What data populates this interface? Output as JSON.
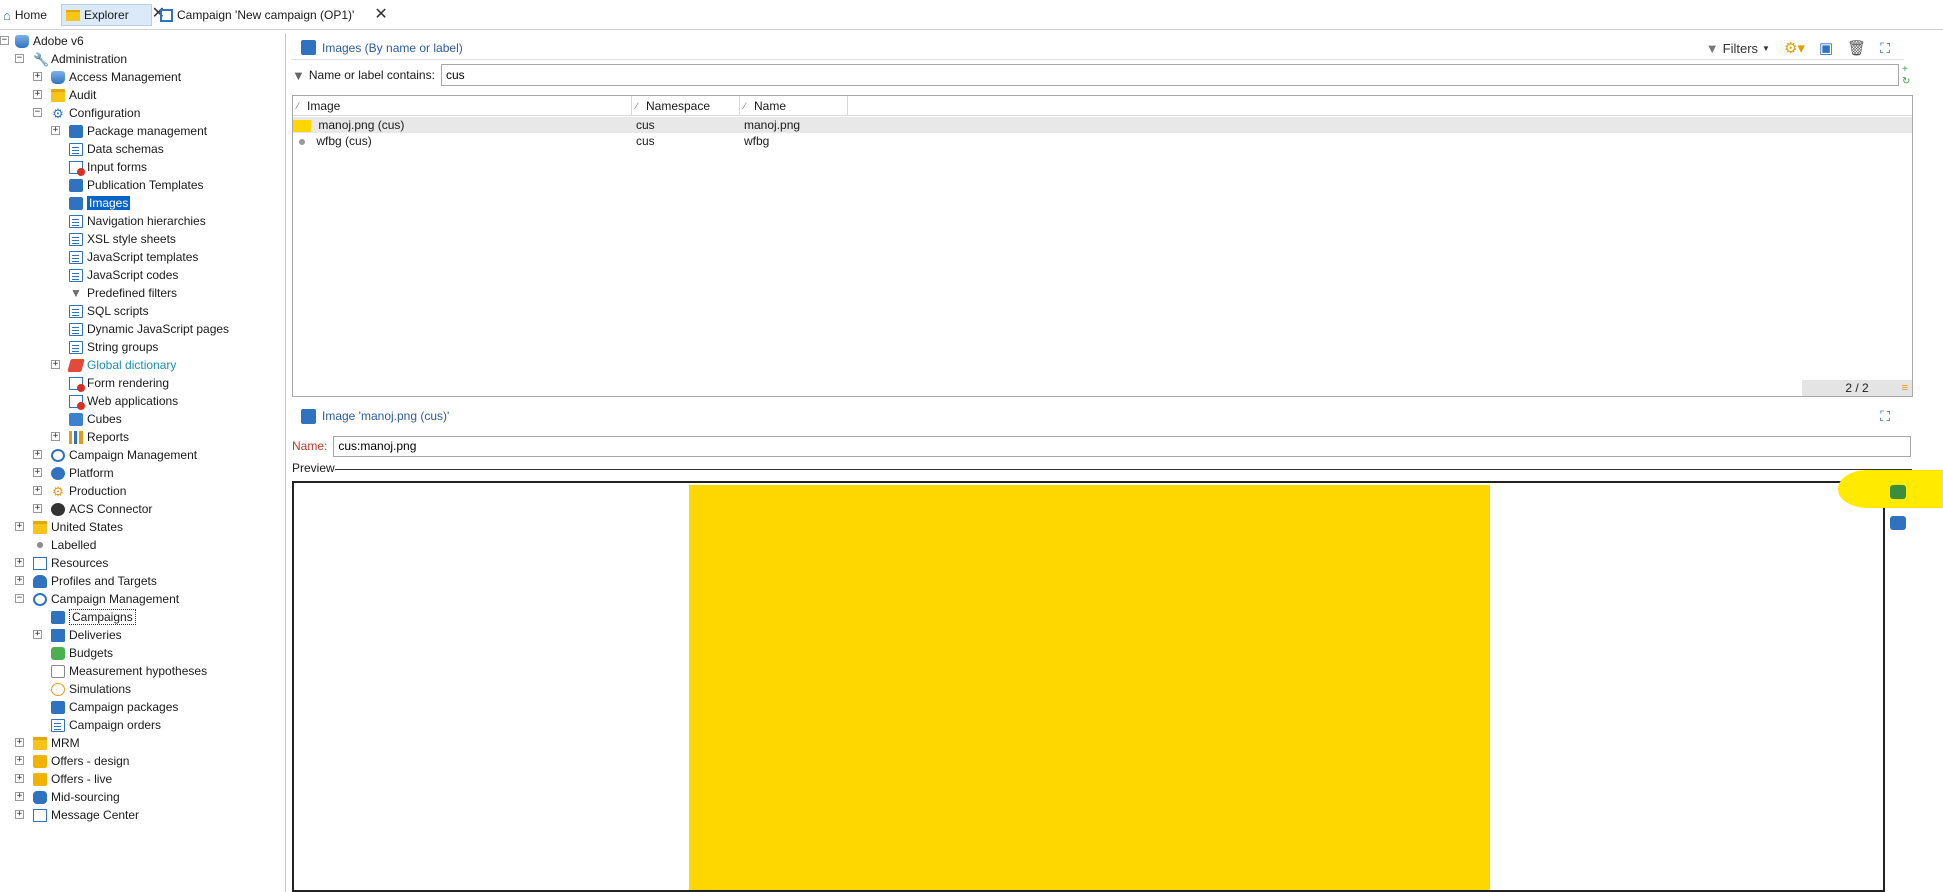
{
  "tabs": [
    {
      "label": "Home"
    },
    {
      "label": "Explorer"
    },
    {
      "label": "Campaign 'New campaign (OP1)'"
    }
  ],
  "tree": [
    {
      "label": "Adobe v6",
      "icon": "database-icon"
    },
    {
      "label": "Administration",
      "icon": "wrench-icon"
    },
    {
      "label": "Access Management",
      "icon": "access-icon"
    },
    {
      "label": "Audit",
      "icon": "folder-icon"
    },
    {
      "label": "Configuration",
      "icon": "gear-icon"
    },
    {
      "label": "Package management",
      "icon": "package-icon"
    },
    {
      "label": "Data schemas",
      "icon": "schema-icon"
    },
    {
      "label": "Input forms",
      "icon": "form-icon"
    },
    {
      "label": "Publication Templates",
      "icon": "template-icon"
    },
    {
      "label": "Images",
      "icon": "images-icon"
    },
    {
      "label": "Navigation hierarchies",
      "icon": "hierarchy-icon"
    },
    {
      "label": "XSL style sheets",
      "icon": "xsl-icon"
    },
    {
      "label": "JavaScript templates",
      "icon": "js-template-icon"
    },
    {
      "label": "JavaScript codes",
      "icon": "js-code-icon"
    },
    {
      "label": "Predefined filters",
      "icon": "filter-icon"
    },
    {
      "label": "SQL scripts",
      "icon": "sql-icon"
    },
    {
      "label": "Dynamic JavaScript pages",
      "icon": "js-page-icon"
    },
    {
      "label": "String groups",
      "icon": "string-icon"
    },
    {
      "label": "Global dictionary",
      "icon": "dictionary-icon"
    },
    {
      "label": "Form rendering",
      "icon": "form-rendering-icon"
    },
    {
      "label": "Web applications",
      "icon": "web-app-icon"
    },
    {
      "label": "Cubes",
      "icon": "cube-icon"
    },
    {
      "label": "Reports",
      "icon": "chart-icon"
    },
    {
      "label": "Campaign Management",
      "icon": "campaign-icon"
    },
    {
      "label": "Platform",
      "icon": "platform-icon"
    },
    {
      "label": "Production",
      "icon": "production-icon"
    },
    {
      "label": "ACS Connector",
      "icon": "acs-icon"
    },
    {
      "label": "United States",
      "icon": "folder-icon"
    },
    {
      "label": "Labelled",
      "icon": "dot-icon"
    },
    {
      "label": "Resources",
      "icon": "resources-icon"
    },
    {
      "label": "Profiles and Targets",
      "icon": "people-icon"
    },
    {
      "label": "Campaign Management",
      "icon": "campaign-icon"
    },
    {
      "label": "Campaigns",
      "icon": "campaigns-icon"
    },
    {
      "label": "Deliveries",
      "icon": "envelope-icon"
    },
    {
      "label": "Budgets",
      "icon": "budget-icon"
    },
    {
      "label": "Measurement hypotheses",
      "icon": "hypothesis-icon"
    },
    {
      "label": "Simulations",
      "icon": "simulation-icon"
    },
    {
      "label": "Campaign packages",
      "icon": "package-icon"
    },
    {
      "label": "Campaign orders",
      "icon": "order-icon"
    },
    {
      "label": "MRM",
      "icon": "mrm-icon"
    },
    {
      "label": "Offers - design",
      "icon": "offer-icon"
    },
    {
      "label": "Offers - live",
      "icon": "offer-icon"
    },
    {
      "label": "Mid-sourcing",
      "icon": "midsourcing-icon"
    },
    {
      "label": "Message Center",
      "icon": "message-icon"
    }
  ],
  "list_panel": {
    "title": "Images (By name or label)",
    "filters_label": "Filters",
    "filter_label": "Name or label contains:",
    "filter_value": "cus",
    "columns": [
      "Image",
      "Namespace",
      "Name"
    ],
    "rows": [
      {
        "image": "manoj.png (cus)",
        "namespace": "cus",
        "name": "manoj.png",
        "swatch_color": "#ffd700"
      },
      {
        "image": "wfbg (cus)",
        "namespace": "cus",
        "name": "wfbg"
      }
    ],
    "count": "2 / 2"
  },
  "detail_panel": {
    "title": "Image 'manoj.png (cus)'",
    "name_label": "Name:",
    "name_value": "cus:manoj.png",
    "preview_label": "Preview",
    "preview_color": "#ffd700"
  },
  "colors": {
    "accent": "#2b5d99",
    "selection": "#0a64c8",
    "highlight": "#ffea00"
  }
}
